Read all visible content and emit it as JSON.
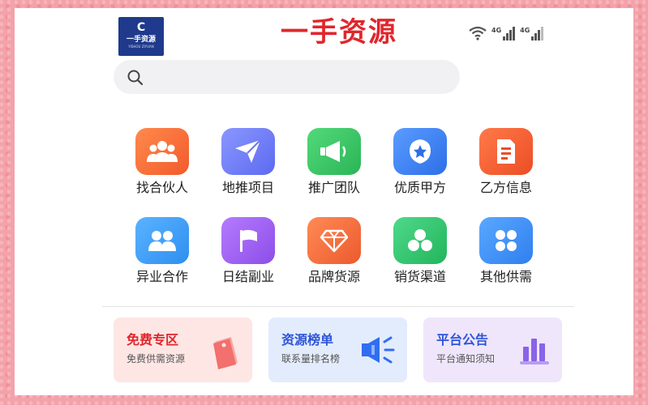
{
  "header": {
    "logo_mark": "C",
    "logo_name": "一手资源",
    "logo_sub": "YISHOU ZIYUAN",
    "title": "一手资源",
    "signal1": "4G",
    "signal2": "4G"
  },
  "search": {
    "placeholder": ""
  },
  "grid": {
    "items": [
      {
        "label": "找合伙人",
        "color": "#f36a3a",
        "icon": "people-icon"
      },
      {
        "label": "地推项目",
        "color": "#6f7cf6",
        "icon": "paper-plane-icon"
      },
      {
        "label": "推广团队",
        "color": "#3dc464",
        "icon": "megaphone-icon"
      },
      {
        "label": "优质甲方",
        "color": "#3b82f3",
        "icon": "star-badge-icon"
      },
      {
        "label": "乙方信息",
        "color": "#f3582d",
        "icon": "document-icon"
      },
      {
        "label": "异业合作",
        "color": "#3d9cf3",
        "icon": "partners-icon"
      },
      {
        "label": "日结副业",
        "color": "#a05ef0",
        "icon": "flag-icon"
      },
      {
        "label": "品牌货源",
        "color": "#f26a3f",
        "icon": "diamond-icon"
      },
      {
        "label": "销货渠道",
        "color": "#34c46a",
        "icon": "hexagons-icon"
      },
      {
        "label": "其他供需",
        "color": "#3b8ff3",
        "icon": "four-petals-icon"
      }
    ]
  },
  "cards": [
    {
      "title": "免费专区",
      "subtitle": "免费供需资源",
      "title_color": "#e0262c",
      "bg": "#fde6e4",
      "icon": "price-tag-icon"
    },
    {
      "title": "资源榜单",
      "subtitle": "联系量排名榜",
      "title_color": "#2f55d8",
      "bg": "#e3ecfd",
      "icon": "speaker-icon"
    },
    {
      "title": "平台公告",
      "subtitle": "平台通知须知",
      "title_color": "#2f55d8",
      "bg": "#efe6fb",
      "icon": "bar-chart-icon"
    }
  ]
}
